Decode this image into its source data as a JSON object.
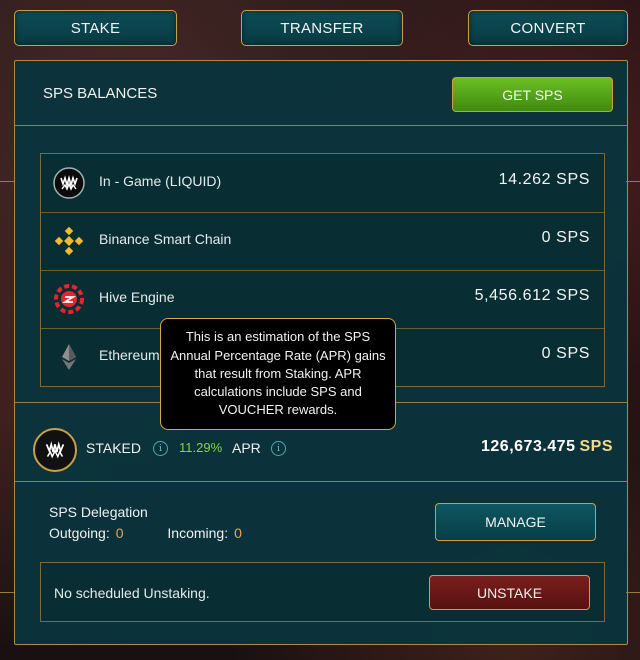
{
  "tabs": [
    {
      "label": "STAKE"
    },
    {
      "label": "TRANSFER"
    },
    {
      "label": "CONVERT"
    }
  ],
  "panel": {
    "title": "SPS BALANCES",
    "get_sps_label": "GET SPS"
  },
  "balances": [
    {
      "icon": "splinterlands-fangs-icon",
      "label": "In - Game (LIQUID)",
      "value": "14.262",
      "unit": "SPS"
    },
    {
      "icon": "binance-icon",
      "label": "Binance Smart Chain",
      "value": "0",
      "unit": "SPS"
    },
    {
      "icon": "hive-engine-icon",
      "label": "Hive Engine",
      "value": "5,456.612",
      "unit": "SPS"
    },
    {
      "icon": "ethereum-icon",
      "label": "Ethereum",
      "value": "0",
      "unit": "SPS"
    }
  ],
  "staked": {
    "label": "STAKED",
    "apr_value": "11.29%",
    "apr_label": "APR",
    "value": "126,673.475",
    "unit": "SPS"
  },
  "tooltip": {
    "text": "This is an estimation of the SPS Annual Percentage Rate (APR) gains that result from Staking. APR calculations include SPS and VOUCHER rewards."
  },
  "delegation": {
    "title": "SPS Delegation",
    "outgoing_label": "Outgoing:",
    "outgoing_value": "0",
    "incoming_label": "Incoming:",
    "incoming_value": "0",
    "manage_label": "MANAGE"
  },
  "unstake": {
    "status_text": "No scheduled Unstaking.",
    "button_label": "UNSTAKE"
  },
  "colors": {
    "accent_gold": "#c9a04a",
    "panel_teal": "#0a343c",
    "apr_green": "#86d63c",
    "get_sps_green": "#5aa81a",
    "unstake_red": "#6e1a18"
  }
}
